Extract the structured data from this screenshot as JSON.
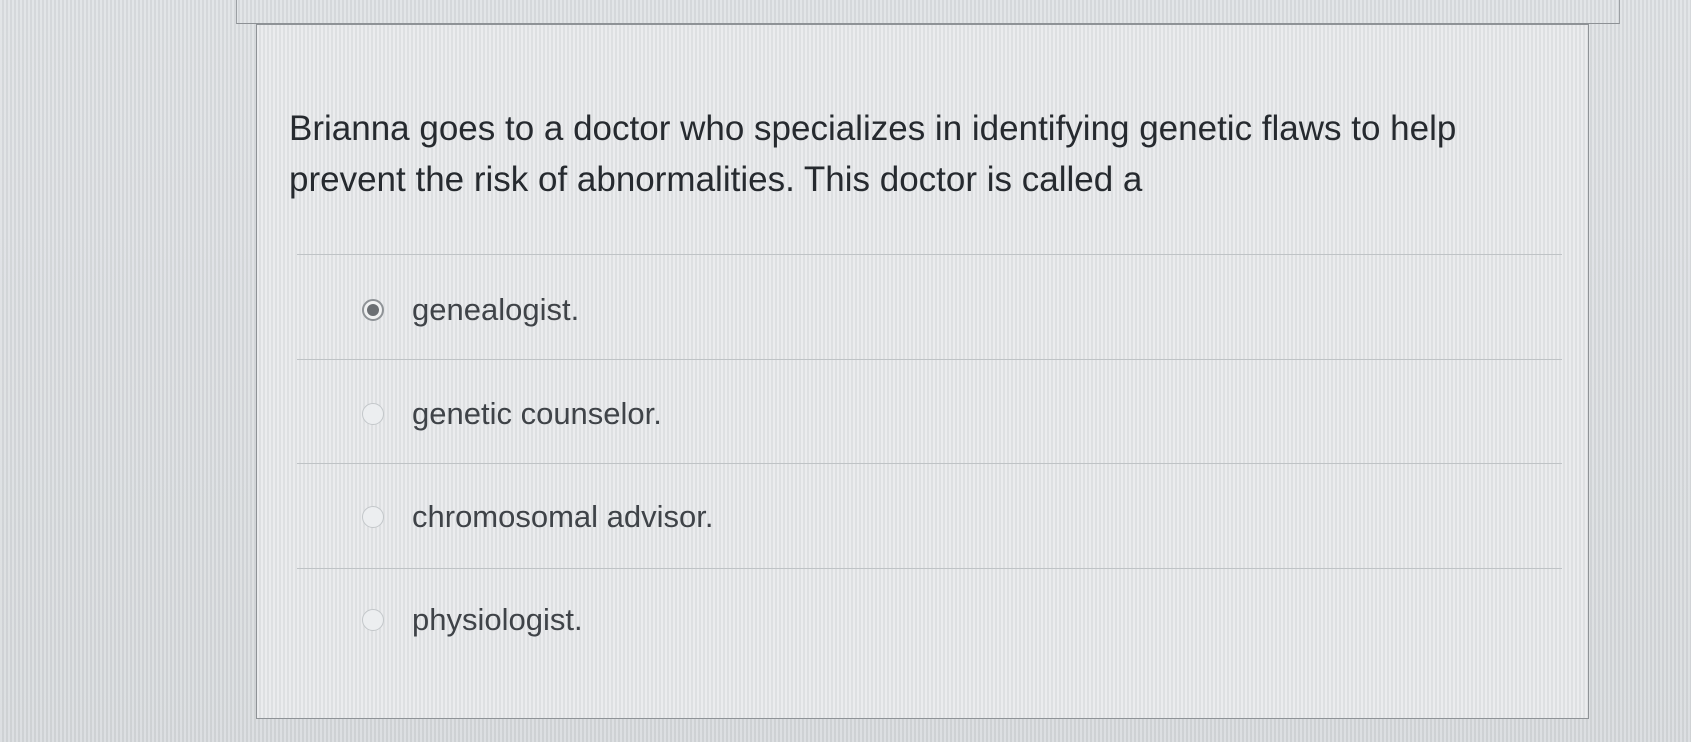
{
  "question": {
    "text": "Brianna goes to a doctor who specializes in identifying genetic flaws to help prevent the risk of abnormalities. This doctor is called a"
  },
  "options": [
    {
      "label": "genealogist.",
      "selected": true
    },
    {
      "label": "genetic counselor.",
      "selected": false
    },
    {
      "label": "chromosomal advisor.",
      "selected": false
    },
    {
      "label": "physiologist.",
      "selected": false
    }
  ],
  "colors": {
    "text": "#262a2f",
    "option_text": "#3f4348",
    "border": "#8f9397",
    "selected_dot": "#6b6f73",
    "background": "#d9dcdf"
  }
}
